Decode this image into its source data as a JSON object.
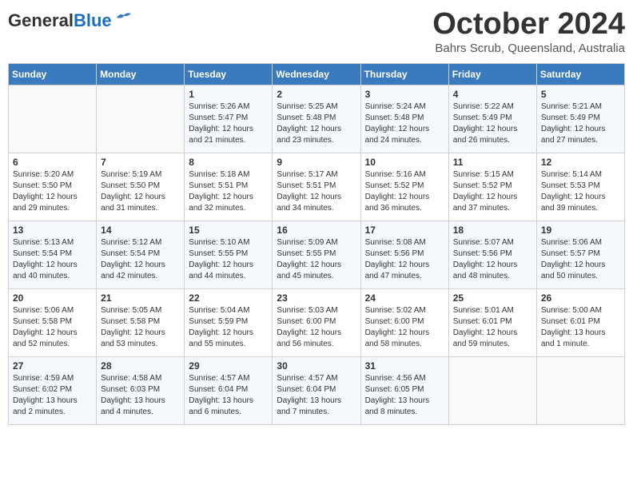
{
  "header": {
    "logo_general": "General",
    "logo_blue": "Blue",
    "title": "October 2024",
    "location": "Bahrs Scrub, Queensland, Australia"
  },
  "weekdays": [
    "Sunday",
    "Monday",
    "Tuesday",
    "Wednesday",
    "Thursday",
    "Friday",
    "Saturday"
  ],
  "weeks": [
    [
      {
        "day": "",
        "sunrise": "",
        "sunset": "",
        "daylight": ""
      },
      {
        "day": "",
        "sunrise": "",
        "sunset": "",
        "daylight": ""
      },
      {
        "day": "1",
        "sunrise": "Sunrise: 5:26 AM",
        "sunset": "Sunset: 5:47 PM",
        "daylight": "Daylight: 12 hours and 21 minutes."
      },
      {
        "day": "2",
        "sunrise": "Sunrise: 5:25 AM",
        "sunset": "Sunset: 5:48 PM",
        "daylight": "Daylight: 12 hours and 23 minutes."
      },
      {
        "day": "3",
        "sunrise": "Sunrise: 5:24 AM",
        "sunset": "Sunset: 5:48 PM",
        "daylight": "Daylight: 12 hours and 24 minutes."
      },
      {
        "day": "4",
        "sunrise": "Sunrise: 5:22 AM",
        "sunset": "Sunset: 5:49 PM",
        "daylight": "Daylight: 12 hours and 26 minutes."
      },
      {
        "day": "5",
        "sunrise": "Sunrise: 5:21 AM",
        "sunset": "Sunset: 5:49 PM",
        "daylight": "Daylight: 12 hours and 27 minutes."
      }
    ],
    [
      {
        "day": "6",
        "sunrise": "Sunrise: 5:20 AM",
        "sunset": "Sunset: 5:50 PM",
        "daylight": "Daylight: 12 hours and 29 minutes."
      },
      {
        "day": "7",
        "sunrise": "Sunrise: 5:19 AM",
        "sunset": "Sunset: 5:50 PM",
        "daylight": "Daylight: 12 hours and 31 minutes."
      },
      {
        "day": "8",
        "sunrise": "Sunrise: 5:18 AM",
        "sunset": "Sunset: 5:51 PM",
        "daylight": "Daylight: 12 hours and 32 minutes."
      },
      {
        "day": "9",
        "sunrise": "Sunrise: 5:17 AM",
        "sunset": "Sunset: 5:51 PM",
        "daylight": "Daylight: 12 hours and 34 minutes."
      },
      {
        "day": "10",
        "sunrise": "Sunrise: 5:16 AM",
        "sunset": "Sunset: 5:52 PM",
        "daylight": "Daylight: 12 hours and 36 minutes."
      },
      {
        "day": "11",
        "sunrise": "Sunrise: 5:15 AM",
        "sunset": "Sunset: 5:52 PM",
        "daylight": "Daylight: 12 hours and 37 minutes."
      },
      {
        "day": "12",
        "sunrise": "Sunrise: 5:14 AM",
        "sunset": "Sunset: 5:53 PM",
        "daylight": "Daylight: 12 hours and 39 minutes."
      }
    ],
    [
      {
        "day": "13",
        "sunrise": "Sunrise: 5:13 AM",
        "sunset": "Sunset: 5:54 PM",
        "daylight": "Daylight: 12 hours and 40 minutes."
      },
      {
        "day": "14",
        "sunrise": "Sunrise: 5:12 AM",
        "sunset": "Sunset: 5:54 PM",
        "daylight": "Daylight: 12 hours and 42 minutes."
      },
      {
        "day": "15",
        "sunrise": "Sunrise: 5:10 AM",
        "sunset": "Sunset: 5:55 PM",
        "daylight": "Daylight: 12 hours and 44 minutes."
      },
      {
        "day": "16",
        "sunrise": "Sunrise: 5:09 AM",
        "sunset": "Sunset: 5:55 PM",
        "daylight": "Daylight: 12 hours and 45 minutes."
      },
      {
        "day": "17",
        "sunrise": "Sunrise: 5:08 AM",
        "sunset": "Sunset: 5:56 PM",
        "daylight": "Daylight: 12 hours and 47 minutes."
      },
      {
        "day": "18",
        "sunrise": "Sunrise: 5:07 AM",
        "sunset": "Sunset: 5:56 PM",
        "daylight": "Daylight: 12 hours and 48 minutes."
      },
      {
        "day": "19",
        "sunrise": "Sunrise: 5:06 AM",
        "sunset": "Sunset: 5:57 PM",
        "daylight": "Daylight: 12 hours and 50 minutes."
      }
    ],
    [
      {
        "day": "20",
        "sunrise": "Sunrise: 5:06 AM",
        "sunset": "Sunset: 5:58 PM",
        "daylight": "Daylight: 12 hours and 52 minutes."
      },
      {
        "day": "21",
        "sunrise": "Sunrise: 5:05 AM",
        "sunset": "Sunset: 5:58 PM",
        "daylight": "Daylight: 12 hours and 53 minutes."
      },
      {
        "day": "22",
        "sunrise": "Sunrise: 5:04 AM",
        "sunset": "Sunset: 5:59 PM",
        "daylight": "Daylight: 12 hours and 55 minutes."
      },
      {
        "day": "23",
        "sunrise": "Sunrise: 5:03 AM",
        "sunset": "Sunset: 6:00 PM",
        "daylight": "Daylight: 12 hours and 56 minutes."
      },
      {
        "day": "24",
        "sunrise": "Sunrise: 5:02 AM",
        "sunset": "Sunset: 6:00 PM",
        "daylight": "Daylight: 12 hours and 58 minutes."
      },
      {
        "day": "25",
        "sunrise": "Sunrise: 5:01 AM",
        "sunset": "Sunset: 6:01 PM",
        "daylight": "Daylight: 12 hours and 59 minutes."
      },
      {
        "day": "26",
        "sunrise": "Sunrise: 5:00 AM",
        "sunset": "Sunset: 6:01 PM",
        "daylight": "Daylight: 13 hours and 1 minute."
      }
    ],
    [
      {
        "day": "27",
        "sunrise": "Sunrise: 4:59 AM",
        "sunset": "Sunset: 6:02 PM",
        "daylight": "Daylight: 13 hours and 2 minutes."
      },
      {
        "day": "28",
        "sunrise": "Sunrise: 4:58 AM",
        "sunset": "Sunset: 6:03 PM",
        "daylight": "Daylight: 13 hours and 4 minutes."
      },
      {
        "day": "29",
        "sunrise": "Sunrise: 4:57 AM",
        "sunset": "Sunset: 6:04 PM",
        "daylight": "Daylight: 13 hours and 6 minutes."
      },
      {
        "day": "30",
        "sunrise": "Sunrise: 4:57 AM",
        "sunset": "Sunset: 6:04 PM",
        "daylight": "Daylight: 13 hours and 7 minutes."
      },
      {
        "day": "31",
        "sunrise": "Sunrise: 4:56 AM",
        "sunset": "Sunset: 6:05 PM",
        "daylight": "Daylight: 13 hours and 8 minutes."
      },
      {
        "day": "",
        "sunrise": "",
        "sunset": "",
        "daylight": ""
      },
      {
        "day": "",
        "sunrise": "",
        "sunset": "",
        "daylight": ""
      }
    ]
  ]
}
